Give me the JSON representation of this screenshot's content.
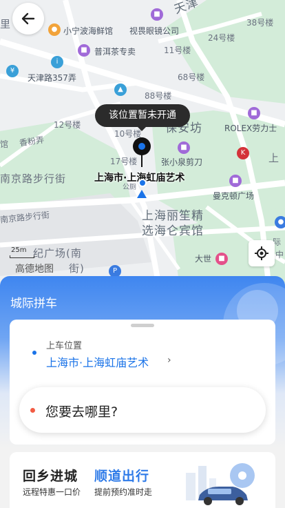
{
  "map": {
    "labels": {
      "tianjin_lu": "天津",
      "xiaoning": "小宁波海鲜馆",
      "shijue": "视畏眼镜公司",
      "li": "里",
      "lou38": "38号楼",
      "lou24": "24号楼",
      "puer": "普洱茶专卖",
      "lou11": "11号楼",
      "tianjin357": "天津路357弄",
      "lou68": "68号楼",
      "lou88": "88号楼",
      "lou12": "12号楼",
      "lou10": "10号楼",
      "baoanfang": "保安坊",
      "rolex": "ROLEX劳力士",
      "guan": "馆",
      "xiangfen": "香粉弄",
      "lou17": "17号楼",
      "zhangxiaoquan": "张小泉剪刀",
      "shang": "上",
      "nanjing1": "南京路步行街",
      "mankedun": "曼克顿广场",
      "nanjing2": "南京路步行街",
      "lijing": "上海丽笙精",
      "xuanhai": "选海仑宾馆",
      "shiji": "纪广场(南",
      "jie": "街)",
      "dashijie": "大世",
      "guoji": "际",
      "zhong": "中",
      "gongce": "公厕"
    },
    "tooltip": "该位置暂未开通",
    "pin_label": "上海市·上海虹庙艺术",
    "scale": "25m",
    "logo_text": "高德地图"
  },
  "panel": {
    "title": "城际拼车",
    "pickup_label": "上车位置",
    "pickup_value": "上海市·上海虹庙艺术",
    "pickup_chevron": "›",
    "destination_placeholder": "您要去哪里?",
    "promo": {
      "title_left": "回乡进城",
      "title_right": "顺道出行",
      "sub_left": "远程特惠一口价",
      "sub_right": "提前预约准时走"
    }
  },
  "colors": {
    "accent": "#1a73e8",
    "panel_top": "#3f86f0",
    "dest_dot": "#f25c44",
    "promo_blue": "#2f7be8"
  },
  "icons": {
    "back": "arrow-left-icon",
    "locate": "crosshair-icon"
  }
}
